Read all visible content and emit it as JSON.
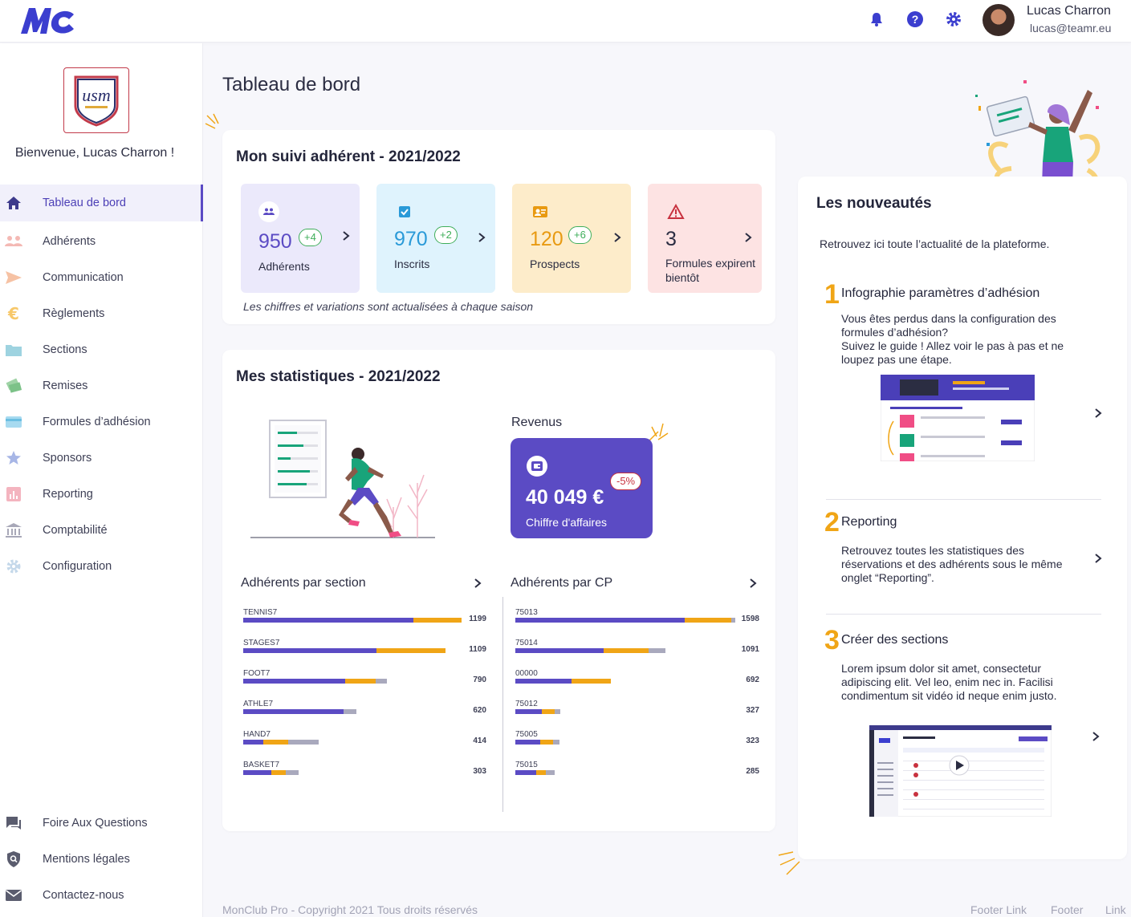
{
  "header": {
    "logo_text": "MC",
    "user_name": "Lucas Charron",
    "user_email": "lucas@teamr.eu",
    "icons": [
      "bell-icon",
      "help-icon",
      "gear-icon"
    ],
    "accent": "#3b3ecf"
  },
  "sidebar": {
    "welcome": "Bienvenue, Lucas Charron !",
    "items": [
      {
        "label": "Tableau de bord",
        "icon": "home-icon",
        "active": true
      },
      {
        "label": "Adhérents",
        "icon": "users-icon"
      },
      {
        "label": "Communication",
        "icon": "send-icon"
      },
      {
        "label": "Règlements",
        "icon": "euro-icon"
      },
      {
        "label": "Sections",
        "icon": "folder-icon"
      },
      {
        "label": "Remises",
        "icon": "ticket-icon"
      },
      {
        "label": "Formules d’adhésion",
        "icon": "card-icon"
      },
      {
        "label": "Sponsors",
        "icon": "star-icon"
      },
      {
        "label": "Reporting",
        "icon": "chart-icon"
      },
      {
        "label": "Comptabilité",
        "icon": "bank-icon"
      },
      {
        "label": "Configuration",
        "icon": "cog-icon"
      }
    ],
    "bottom_items": [
      {
        "label": "Foire Aux Questions",
        "icon": "chat-icon"
      },
      {
        "label": "Mentions légales",
        "icon": "shield-icon"
      },
      {
        "label": "Contactez-nous",
        "icon": "mail-icon"
      }
    ]
  },
  "main": {
    "page_title": "Tableau de bord",
    "suivi": {
      "title": "Mon suivi adhérent - 2021/2022",
      "kpis": [
        {
          "value": "950",
          "delta": "+4",
          "label": "Adhérents",
          "bg": "#ebe9fb",
          "color": "#5b4bc4"
        },
        {
          "value": "970",
          "delta": "+2",
          "label": "Inscrits",
          "bg": "#dff3fd",
          "color": "#2a9ad8"
        },
        {
          "value": "120",
          "delta": "+6",
          "label": "Prospects",
          "bg": "#fdecca",
          "color": "#e89a12"
        },
        {
          "value": "3",
          "delta": "",
          "label": "Formules expirent bientôt",
          "bg": "#fde3e3",
          "color": "#2b2d42"
        }
      ],
      "note": "Les chiffres et variations sont actualisées à chaque saison"
    },
    "stats": {
      "title": "Mes statistiques - 2021/2022",
      "revenue_label": "Revenus",
      "revenue_value": "40 049 €",
      "revenue_sub": "Chiffre d'affaires",
      "revenue_delta": "-5%",
      "section_chart_title": "Adhérents par section",
      "cp_chart_title": "Adhérents par CP"
    }
  },
  "chart_data": [
    {
      "type": "bar",
      "title": "Adhérents par section",
      "categories": [
        "TENNIS7",
        "STAGES7",
        "FOOT7",
        "ATHLE7",
        "HAND7",
        "BASKET7"
      ],
      "values": [
        1199,
        1109,
        790,
        620,
        414,
        303
      ],
      "segments": [
        [
          0.78,
          0.22,
          0
        ],
        [
          0.66,
          0.34,
          0
        ],
        [
          0.71,
          0.21,
          0.08
        ],
        [
          0.89,
          0,
          0.11
        ],
        [
          0.27,
          0.33,
          0.4
        ],
        [
          0.51,
          0.26,
          0.23
        ]
      ],
      "segment_colors": [
        "#5b4bc4",
        "#f0a516",
        "#a9a9bd"
      ]
    },
    {
      "type": "bar",
      "title": "Adhérents par CP",
      "categories": [
        "75013",
        "75014",
        "00000",
        "75012",
        "75005",
        "75015"
      ],
      "values": [
        1598,
        1091,
        692,
        327,
        323,
        285
      ],
      "segments": [
        [
          0.77,
          0.21,
          0.02
        ],
        [
          0.59,
          0.3,
          0.11
        ],
        [
          0.59,
          0.41,
          0
        ],
        [
          0.58,
          0.3,
          0.12
        ],
        [
          0.56,
          0.28,
          0.16
        ],
        [
          0.53,
          0.24,
          0.23
        ]
      ],
      "segment_colors": [
        "#5b4bc4",
        "#f0a516",
        "#a9a9bd"
      ]
    }
  ],
  "news": {
    "title": "Les nouveautés",
    "intro": "Retrouvez ici toute l’actualité de la plateforme.",
    "items": [
      {
        "num": "1",
        "title": "Infographie paramètres d’adhésion",
        "body": "Vous êtes perdus dans la configuration des formules d’adhésion?\nSuivez le guide ! Allez voir le pas à pas et ne loupez pas une étape."
      },
      {
        "num": "2",
        "title": "Reporting",
        "body": "Retrouvez toutes les statistiques des réservations et des adhérents sous le même onglet “Reporting”."
      },
      {
        "num": "3",
        "title": "Créer des sections",
        "body": "Lorem ipsum dolor sit amet, consectetur adipiscing elit. Vel leo, enim nec in. Facilisi condimentum sit vidéo id neque enim justo."
      }
    ]
  },
  "footer": {
    "copyright": "MonClub Pro - Copyright 2021 Tous droits réservés",
    "links": [
      "Footer Link",
      "Footer",
      "Link"
    ]
  }
}
